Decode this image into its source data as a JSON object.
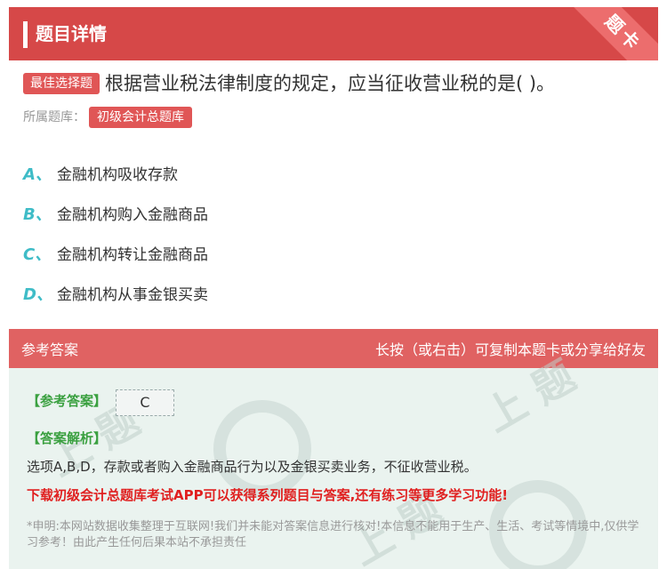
{
  "header": {
    "title": "题目详情",
    "corner_label": "题卡"
  },
  "question": {
    "type_badge": "最佳选择题",
    "text": "根据营业税法律制度的规定，应当征收营业税的是( )。",
    "bank_label": "所属题库：",
    "bank_name": "初级会计总题库"
  },
  "options": [
    {
      "letter": "A、",
      "text": "金融机构吸收存款"
    },
    {
      "letter": "B、",
      "text": "金融机构购入金融商品"
    },
    {
      "letter": "C、",
      "text": "金融机构转让金融商品"
    },
    {
      "letter": "D、",
      "text": "金融机构从事金银买卖"
    }
  ],
  "answer_section": {
    "title": "参考答案",
    "hint": "长按（或右击）可复制本题卡或分享给好友",
    "answer_tag": "【参考答案】",
    "answer_value": "C",
    "analysis_tag": "【答案解析】",
    "analysis_text": "选项A,B,D，存款或者购入金融商品行为以及金银买卖业务，不征收营业税。",
    "promo": "下载初级会计总题库考试APP可以获得系列题目与答案,还有练习等更多学习功能!",
    "disclaimer": "*申明:本网站数据收集整理于互联网!我们并未能对答案信息进行核对!本信息不能用于生产、生活、考试等情境中,仅供学习参考！由此产生任何后果本站不承担责任"
  },
  "colors": {
    "brand_red": "#d64848",
    "option_letter": "#3fbcc7",
    "answer_bg": "#eaf3ef",
    "tag_green": "#3aa040",
    "promo_red": "#e02020"
  }
}
